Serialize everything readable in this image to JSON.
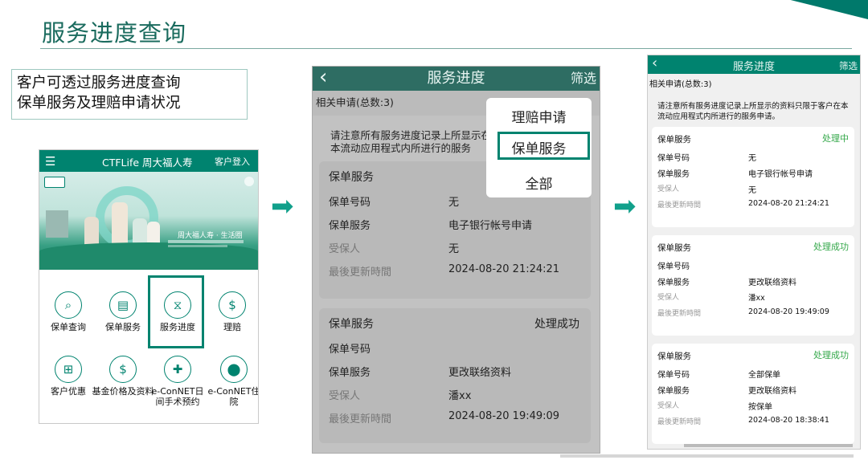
{
  "slide": {
    "title": "服务进度查询",
    "description_line1": "客户可透过服务进度查询",
    "description_line2": "保单服务及理赔申请状况"
  },
  "home_screen": {
    "menu_icon": "menu-icon",
    "brand": "CTFLife 周大福人寿",
    "login": "客户登入",
    "slogan": "周大福人寿 · 生活圈",
    "services": [
      {
        "label": "保单查询",
        "icon": "magnifier-icon"
      },
      {
        "label": "保单服务",
        "icon": "document-icon"
      },
      {
        "label": "服务进度",
        "icon": "hourglass-icon"
      },
      {
        "label": "理赔",
        "icon": "shield-dollar-icon"
      },
      {
        "label": "客户优惠",
        "icon": "gift-icon"
      },
      {
        "label": "基金价格及资料",
        "icon": "dollar-coin-icon"
      },
      {
        "label": "e-ConNET日间手术预约",
        "icon": "calendar-icon"
      },
      {
        "label": "e-ConNET住院",
        "icon": "location-pin-icon"
      }
    ]
  },
  "progress_screen": {
    "back_icon": "chevron-left-icon",
    "title": "服务进度",
    "filter": "筛选",
    "total": "相关申请(总数:3)",
    "notice": "请注意所有服务进度记录上所显示的资料只限于在本流动应用程式内所进行的服务",
    "notice_visible": "请注意所有服务进度记录上所显示在本流动应用程式内所进行的服务",
    "filter_options": [
      "理赔申请",
      "保单服务",
      "全部"
    ],
    "selected_option": "保单服务",
    "cards": [
      {
        "type": "保单服务",
        "status": "",
        "policy_no_label": "保单号码",
        "policy_no": "无",
        "service_label": "保单服务",
        "service": "电子银行帐号申请",
        "insured_label": "受保人",
        "insured": "无",
        "updated_label": "最後更新時間",
        "updated": "2024-08-20 21:24:21"
      },
      {
        "type": "保单服务",
        "status": "处理成功",
        "policy_no_label": "保单号码",
        "policy_no": "",
        "service_label": "保单服务",
        "service": "更改联络资料",
        "insured_label": "受保人",
        "insured": "潘xx",
        "updated_label": "最後更新時間",
        "updated": "2024-08-20 19:49:09"
      }
    ]
  },
  "result_screen": {
    "back_icon": "chevron-left-icon",
    "title": "服务进度",
    "filter": "筛选",
    "total": "相关申请(总数:3)",
    "notice": "请注意所有服务进度记录上所显示的资料只限于本流动应用程式内所进行的服务申请。",
    "notice_display": "请注意所有服务进度记录上所显示的资料只限于客户在本流动应用程式内所进行的服务申请。",
    "cards": [
      {
        "type": "保单服务",
        "status": "处理中",
        "policy_no_label": "保单号码",
        "policy_no": "无",
        "service_label": "保单服务",
        "service": "电子银行帐号申请",
        "insured_label": "受保人",
        "insured": "无",
        "updated_label": "最後更新時間",
        "updated": "2024-08-20 21:24:21"
      },
      {
        "type": "保单服务",
        "status": "处理成功",
        "policy_no_label": "保单号码",
        "policy_no": "",
        "service_label": "保单服务",
        "service": "更改联络资料",
        "insured_label": "受保人",
        "insured": "潘xx",
        "updated_label": "最後更新時間",
        "updated": "2024-08-20 19:49:09"
      },
      {
        "type": "保单服务",
        "status": "处理成功",
        "policy_no_label": "保单号码",
        "policy_no": "全部保单",
        "service_label": "保单服务",
        "service": "更改联络资料",
        "insured_label": "受保人",
        "insured": "按保单",
        "updated_label": "最後更新時間",
        "updated": "2024-08-20 18:38:41"
      }
    ]
  },
  "colors": {
    "brand_green": "#00836f",
    "title_green": "#1a6b5e",
    "success_green": "#34a84a",
    "arrow_teal": "#11a08b"
  }
}
